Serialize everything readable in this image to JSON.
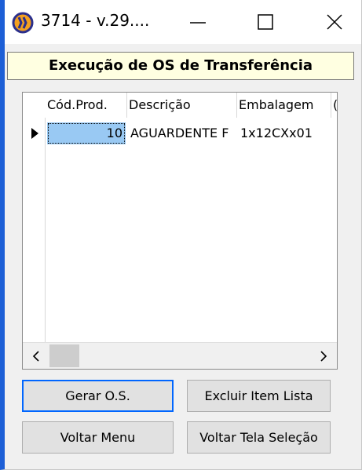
{
  "window": {
    "title": "3714 - v.29....",
    "icon": "app-logo-icon",
    "controls": [
      "minimize-icon",
      "maximize-icon",
      "close-icon"
    ]
  },
  "header": {
    "title": "Execução de OS de Transferência"
  },
  "grid": {
    "columns": [
      "Cód.Prod.",
      "Descrição",
      "Embalagem",
      "("
    ],
    "rows": [
      {
        "code": "10",
        "description": "AGUARDENTE F",
        "packaging": "1x12CXx01"
      }
    ]
  },
  "buttons": {
    "gerar_os": "Gerar O.S.",
    "excluir_item": "Excluir Item Lista",
    "voltar_menu": "Voltar Menu",
    "voltar_tela": "Voltar Tela Seleção"
  },
  "colors": {
    "accent_border": "#1d5fd6",
    "header_bg": "#ffffe1",
    "selected_cell": "#99c9f3",
    "focus_border": "#0066ff"
  }
}
